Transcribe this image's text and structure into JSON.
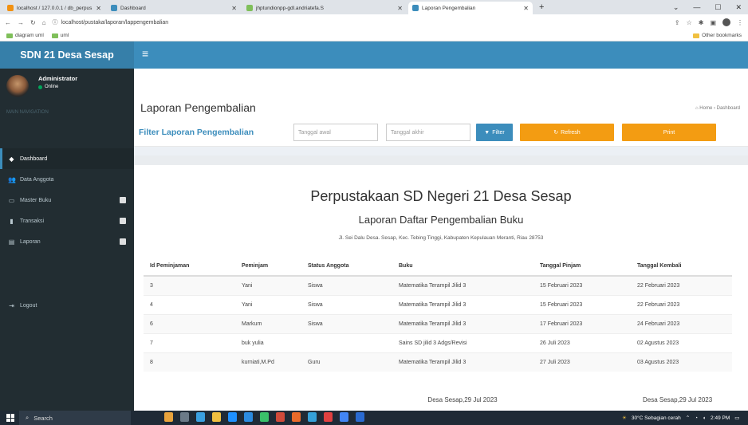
{
  "browser": {
    "tabs": [
      {
        "label": "localhost / 127.0.0.1 / db_perpus",
        "color": "#f29111"
      },
      {
        "label": "Dashboard",
        "color": "#3c8dbc"
      },
      {
        "label": "jhptundionpp-gdl.andriatefa.S",
        "color": "#3c8dbc"
      },
      {
        "label": "Laporan Pengembalian",
        "color": "#3c8dbc"
      }
    ],
    "new_tab": "+",
    "url": "localhost/pustaka/laporan/lappengembalian",
    "bookmarks": [
      "diagram uml",
      "uml"
    ],
    "other_bookmarks": "Other bookmarks"
  },
  "app": {
    "brand": "SDN 21 Desa Sesap",
    "user_name": "Administrator",
    "user_status": "Online",
    "nav_header": "MAIN NAVIGATION",
    "nav": [
      {
        "label": "Dashboard",
        "icon": "dashboard-icon",
        "glyph": "◆"
      },
      {
        "label": "Data Anggota",
        "icon": "users-icon",
        "glyph": "👥"
      },
      {
        "label": "Master Buku",
        "icon": "desktop-icon",
        "glyph": "▭"
      },
      {
        "label": "Transaksi",
        "icon": "chart-icon",
        "glyph": "▮"
      },
      {
        "label": "Laporan",
        "icon": "book-icon",
        "glyph": "▤"
      },
      {
        "label": "Logout",
        "icon": "logout-icon",
        "glyph": "⇥"
      }
    ]
  },
  "page": {
    "title": "Laporan Pengembalian",
    "breadcrumb_home": "Home",
    "breadcrumb_current": "Dashboard",
    "filter_label": "Filter Laporan Pengembalian",
    "start_placeholder": "Tanggal awal",
    "end_placeholder": "Tanggal akhir",
    "filter_btn": "Filter",
    "refresh_btn": "Refresh",
    "print_btn": "Print"
  },
  "report": {
    "title": "Perpustakaan SD Negeri 21 Desa Sesap",
    "subtitle": "Laporan Daftar Pengembalian Buku",
    "address": "Jl. Sei Dalu Desa. Sesap, Kec. Tebing Tinggi, Kabupaten Kepulauan Meranti, Riau 28753",
    "columns": [
      "Id Peminjaman",
      "Peminjam",
      "Status Anggota",
      "Buku",
      "Tanggal Pinjam",
      "Tanggal Kembali"
    ],
    "rows": [
      [
        "3",
        "Yani",
        "Siswa",
        "Matematika Terampil Jilid 3",
        "15 Februari 2023",
        "22 Februari 2023"
      ],
      [
        "4",
        "Yani",
        "Siswa",
        "Matematika Terampil Jilid 3",
        "15 Februari 2023",
        "22 Februari 2023"
      ],
      [
        "6",
        "Markum",
        "Siswa",
        "Matematika Terampil Jilid 3",
        "17 Februari 2023",
        "24 Februari 2023"
      ],
      [
        "7",
        "buk yulia",
        "",
        "Sains SD jilid 3 Adgs/Revisi",
        "26 Juli 2023",
        "02 Agustus 2023"
      ],
      [
        "8",
        "kurniati,M.Pd",
        "Guru",
        "Matematika Terampil Jilid 3",
        "27 Juli 2023",
        "03 Agustus 2023"
      ]
    ],
    "footer_left": "Desa Sesap,29 Jul 2023",
    "footer_right": "Desa Sesap,29 Jul 2023"
  },
  "taskbar": {
    "search": "Search",
    "weather": "30°C Sebagian cerah",
    "time": "2:49 PM"
  }
}
